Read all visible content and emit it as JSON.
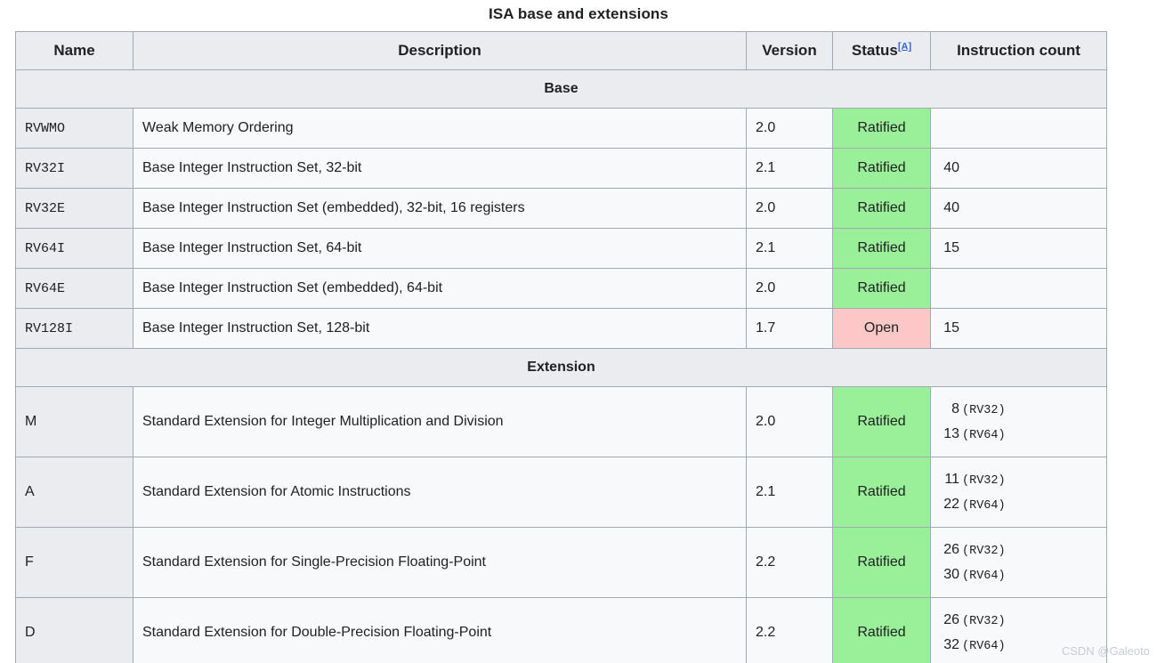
{
  "table": {
    "caption": "ISA base and extensions",
    "columns": {
      "name": "Name",
      "description": "Description",
      "version": "Version",
      "status": "Status",
      "status_ref": "[A]",
      "instruction_count": "Instruction count"
    },
    "sections": [
      {
        "title": "Base",
        "rows": [
          {
            "name": "RVWMO",
            "name_font": "mono",
            "description": "Weak Memory Ordering",
            "version": "2.0",
            "status": "Ratified",
            "status_kind": "ratified",
            "counts": []
          },
          {
            "name": "RV32I",
            "name_font": "mono",
            "description": "Base Integer Instruction Set, 32-bit",
            "version": "2.1",
            "status": "Ratified",
            "status_kind": "ratified",
            "counts": [
              {
                "num": "40",
                "tag": ""
              }
            ]
          },
          {
            "name": "RV32E",
            "name_font": "mono",
            "description": "Base Integer Instruction Set (embedded), 32-bit, 16 registers",
            "version": "2.0",
            "status": "Ratified",
            "status_kind": "ratified",
            "counts": [
              {
                "num": "40",
                "tag": ""
              }
            ]
          },
          {
            "name": "RV64I",
            "name_font": "mono",
            "description": "Base Integer Instruction Set, 64-bit",
            "version": "2.1",
            "status": "Ratified",
            "status_kind": "ratified",
            "counts": [
              {
                "num": "15",
                "tag": ""
              }
            ]
          },
          {
            "name": "RV64E",
            "name_font": "mono",
            "description": "Base Integer Instruction Set (embedded), 64-bit",
            "version": "2.0",
            "status": "Ratified",
            "status_kind": "ratified",
            "counts": []
          },
          {
            "name": "RV128I",
            "name_font": "mono",
            "description": "Base Integer Instruction Set, 128-bit",
            "version": "1.7",
            "status": "Open",
            "status_kind": "open",
            "counts": [
              {
                "num": "15",
                "tag": ""
              }
            ]
          }
        ]
      },
      {
        "title": "Extension",
        "rows": [
          {
            "name": "M",
            "name_font": "sans",
            "description": "Standard Extension for Integer Multiplication and Division",
            "version": "2.0",
            "status": "Ratified",
            "status_kind": "ratified",
            "counts": [
              {
                "num": "8",
                "tag": "(RV32)"
              },
              {
                "num": "13",
                "tag": "(RV64)"
              }
            ]
          },
          {
            "name": "A",
            "name_font": "sans",
            "description": "Standard Extension for Atomic Instructions",
            "version": "2.1",
            "status": "Ratified",
            "status_kind": "ratified",
            "counts": [
              {
                "num": "11",
                "tag": "(RV32)"
              },
              {
                "num": "22",
                "tag": "(RV64)"
              }
            ]
          },
          {
            "name": "F",
            "name_font": "sans",
            "description": "Standard Extension for Single-Precision Floating-Point",
            "version": "2.2",
            "status": "Ratified",
            "status_kind": "ratified",
            "counts": [
              {
                "num": "26",
                "tag": "(RV32)"
              },
              {
                "num": "30",
                "tag": "(RV64)"
              }
            ]
          },
          {
            "name": "D",
            "name_font": "sans",
            "description": "Standard Extension for Double-Precision Floating-Point",
            "version": "2.2",
            "status": "Ratified",
            "status_kind": "ratified",
            "counts": [
              {
                "num": "26",
                "tag": "(RV32)"
              },
              {
                "num": "32",
                "tag": "(RV64)"
              }
            ]
          }
        ]
      }
    ]
  },
  "watermark": {
    "text": "CSDN @Galeoto"
  },
  "colors": {
    "ratified_bg": "#99f099",
    "open_bg": "#fdc7c7",
    "header_bg": "#eaecf0",
    "cell_bg": "#f8f9fa",
    "border": "#a2a9b1",
    "ref_link": "#3366cc"
  }
}
